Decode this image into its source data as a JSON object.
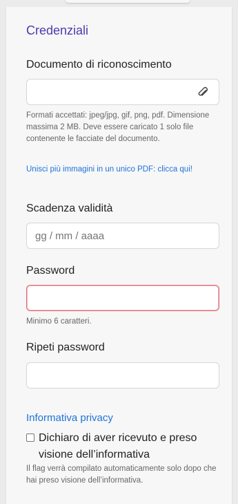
{
  "section": {
    "title": "Credenziali"
  },
  "document": {
    "label": "Documento di riconoscimento",
    "help": "Formati accettati: jpeg/jpg, gif, png, pdf. Dimensione massima 2 MB. Deve essere caricato 1 solo file contenente le facciate del documento.",
    "link": "Unisci più immagini in un unico PDF: clicca qui!"
  },
  "expiry": {
    "label": "Scadenza validità",
    "placeholder": "gg / mm / aaaa"
  },
  "password": {
    "label": "Password",
    "hint": "Minimo 6 caratteri."
  },
  "repeat_password": {
    "label": "Ripeti password"
  },
  "privacy": {
    "link": "Informativa privacy",
    "checkbox_label": "Dichiaro di aver ricevuto e preso visione dell’informativa",
    "note": "Il flag verrà compilato automaticamente solo dopo che hai preso visione dell’informativa."
  },
  "colors": {
    "accent": "#4b3bb0",
    "link": "#1f72d8",
    "error": "#e06a76"
  }
}
